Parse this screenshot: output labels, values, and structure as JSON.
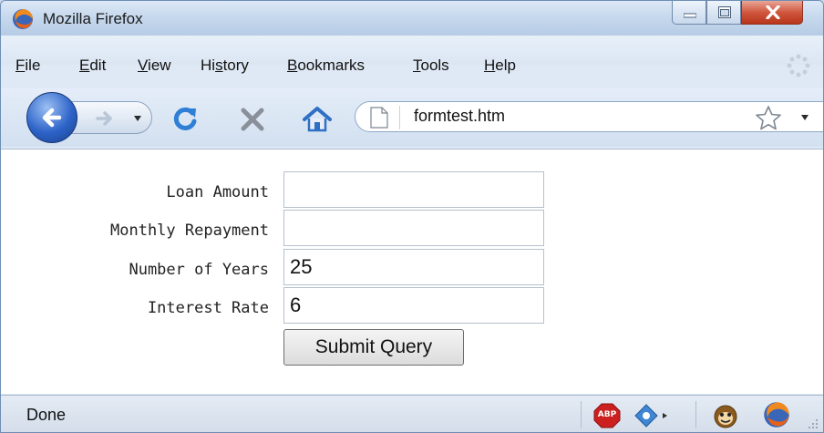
{
  "window": {
    "title": "Mozilla Firefox"
  },
  "menu": {
    "items": [
      {
        "key": "F",
        "rest": "ile"
      },
      {
        "key": "E",
        "rest": "dit"
      },
      {
        "key": "V",
        "rest": "iew"
      },
      {
        "pre": "Hi",
        "key": "s",
        "rest": "tory"
      },
      {
        "key": "B",
        "rest": "ookmarks"
      },
      {
        "key": "T",
        "rest": "ools"
      },
      {
        "key": "H",
        "rest": "elp"
      }
    ]
  },
  "navbar": {
    "url": "formtest.htm"
  },
  "form": {
    "loan_amount_label": "Loan Amount",
    "loan_amount_value": "",
    "monthly_repayment_label": "Monthly Repayment",
    "monthly_repayment_value": "",
    "years_label": "Number of Years",
    "years_value": "25",
    "rate_label": "Interest Rate",
    "rate_value": "6",
    "submit_label": "Submit Query"
  },
  "status": {
    "text": "Done",
    "adblock_label": "ABP"
  },
  "colors": {
    "accent": "#2d63c8",
    "close": "#c8442a",
    "reload": "#2f7fd6",
    "stop": "#8a9099"
  },
  "icons": [
    "firefox-logo-icon",
    "minimize-icon",
    "maximize-icon",
    "close-icon",
    "back-arrow-icon",
    "forward-arrow-icon",
    "reload-icon",
    "stop-icon",
    "home-icon",
    "page-icon",
    "bookmark-star-icon",
    "adblock-icon",
    "flash-icon",
    "greasemonkey-icon",
    "firefox-status-icon"
  ]
}
